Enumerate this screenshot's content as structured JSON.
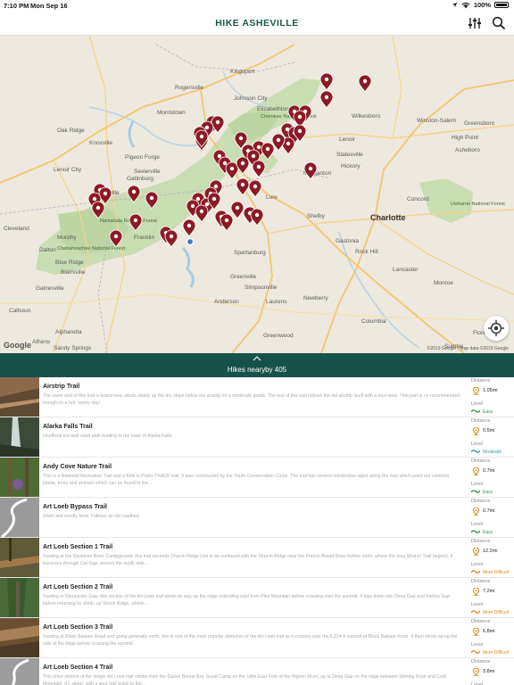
{
  "status": {
    "time": "7:10 PM",
    "date": "Mon Sep 16",
    "battery": "100%"
  },
  "header": {
    "title": "HIKE ASHEVILLE",
    "filter_icon": "filter-sliders-icon",
    "search_icon": "search-icon"
  },
  "map": {
    "places": [
      {
        "name": "Kingsport"
      },
      {
        "name": "Johnson City"
      },
      {
        "name": "Rogersville"
      },
      {
        "name": "Elizabethton"
      },
      {
        "name": "Morristown"
      },
      {
        "name": "Oak Ridge"
      },
      {
        "name": "Knoxville"
      },
      {
        "name": "Pigeon Forge"
      },
      {
        "name": "Gatlinburg"
      },
      {
        "name": "Maryville"
      },
      {
        "name": "Sevierville"
      },
      {
        "name": "Lenoir City"
      },
      {
        "name": "Cherokee National Forest"
      },
      {
        "name": "Wilkesboro"
      },
      {
        "name": "Winston-Salem"
      },
      {
        "name": "Greensboro"
      },
      {
        "name": "High Point"
      },
      {
        "name": "Statesville"
      },
      {
        "name": "Hickory"
      },
      {
        "name": "Morganton"
      },
      {
        "name": "Lenoir"
      },
      {
        "name": "Asheboro"
      },
      {
        "name": "Concord"
      },
      {
        "name": "Lure"
      },
      {
        "name": "Shelby"
      },
      {
        "name": "Charlotte"
      },
      {
        "name": "Gastonia"
      },
      {
        "name": "Rock Hill"
      },
      {
        "name": "Spartanburg"
      },
      {
        "name": "Greenville"
      },
      {
        "name": "Simpsonville"
      },
      {
        "name": "Anderson"
      },
      {
        "name": "Greenwood"
      },
      {
        "name": "Columbia"
      },
      {
        "name": "Monroe"
      },
      {
        "name": "Uwharrie National Forest"
      },
      {
        "name": "Nantahala National Forest"
      },
      {
        "name": "Chattahoochee National Forest"
      },
      {
        "name": "Blue Ridge"
      },
      {
        "name": "Blairsville"
      },
      {
        "name": "Murphy"
      },
      {
        "name": "Franklin"
      },
      {
        "name": "Cleveland"
      },
      {
        "name": "Dalton"
      },
      {
        "name": "Calhoun"
      },
      {
        "name": "Athens"
      },
      {
        "name": "Alpharetta"
      },
      {
        "name": "Sandy Springs"
      },
      {
        "name": "Gainesville"
      },
      {
        "name": "Florence"
      },
      {
        "name": "Sumter"
      },
      {
        "name": "Newberry"
      },
      {
        "name": "Lancaster"
      },
      {
        "name": "Laurens"
      }
    ],
    "google_label": "Google",
    "copyright": "©2019 Google · Map data ©2019 Google",
    "locate_icon": "locate-me-icon"
  },
  "banner": {
    "text": "Hikes nearyby 405",
    "chevron_icon": "chevron-up-icon"
  },
  "labels": {
    "distance": "Distance",
    "level": "Level"
  },
  "colors": {
    "brand": "#16594a",
    "banner": "#17524a",
    "easy": "#2e9b3e",
    "moderate": "#2a9f9a",
    "difficult": "#e08a1e",
    "marker": "#8c1a25"
  },
  "trails": [
    {
      "name": "Airstrip Trail",
      "desc": "The lower end of this trail is brand new, winds slowly up the dry slope below the airstrip on a moderate grade. The rest of this trail follows the old airstrip itself with a nice view. That part is no recommended, though on a hot, sunny day!",
      "distance": "1.05mi",
      "level": "Easy",
      "level_key": "easy"
    },
    {
      "name": "Alarka Falls Trail",
      "desc": "Unofficial but well-used path leading to the base of Alarka Falls.",
      "distance": "0.5mi",
      "level": "Moderate",
      "level_key": "moderate"
    },
    {
      "name": "Andy Cove Nature Trail",
      "desc": "This is a National Recreation Trail and a Kids in Parks TRACK trail. It was constructed by the Youth Conservation Corps. The trail has several interpretive signs along the way which point out common plants, trees and animals which can be found in the...",
      "distance": "0.7mi",
      "level": "Easy",
      "level_key": "easy"
    },
    {
      "name": "Art Loeb Bypass Trail",
      "desc": "Short and mostly level. Follows an old roadbed.",
      "distance": "0.7mi",
      "level": "Easy",
      "level_key": "easy"
    },
    {
      "name": "Art Loeb Section 1 Trail",
      "desc": "Starting at the Davidson River Campground, this trail ascends Shut-in Ridge (not to be confused with the Shut-in Ridge near the French Broad River further north, where the long Shut-in Trail begins). It traverses through Cat Gap, around the south side...",
      "distance": "12.2mi",
      "level": "More Difficult",
      "level_key": "difficult"
    },
    {
      "name": "Art Loeb Section 2 Trail",
      "desc": "Starting in Gloucester Gap, this section of the Art Loeb trail winds its way up the ridge extending east from Pilot Mountain before crossing over the summit. It dips down into Deep Gap and Farlow Gap before returning its climb, up Shuck Ridge, where...",
      "distance": "7.2mi",
      "level": "More Difficult",
      "level_key": "difficult"
    },
    {
      "name": "Art Loeb Section 3 Trail",
      "desc": "Starting at Black Balsam Road and going generally north, this is one of the most popular stretches of the Art Loeb trail as it crosses over the 6,214 ft summit of Black Balsam Knob. It then winds along the side of the ridge before crossing the summit...",
      "distance": "6.8mi",
      "level": "More Difficult",
      "level_key": "difficult"
    },
    {
      "name": "Art Loeb Section 4 Trail",
      "desc": "This short section of the longer Art Loeb trail climbs from the Daniel Boone Boy Scout Camp on the Little East Fork of the Pigeon River, up to Deep Gap on the ridge between Shining Rock and Cold Mountain. It's steep, with a sour trail leads to the...",
      "distance": "3.8mi",
      "level": "More Difficult",
      "level_key": "difficult"
    }
  ]
}
